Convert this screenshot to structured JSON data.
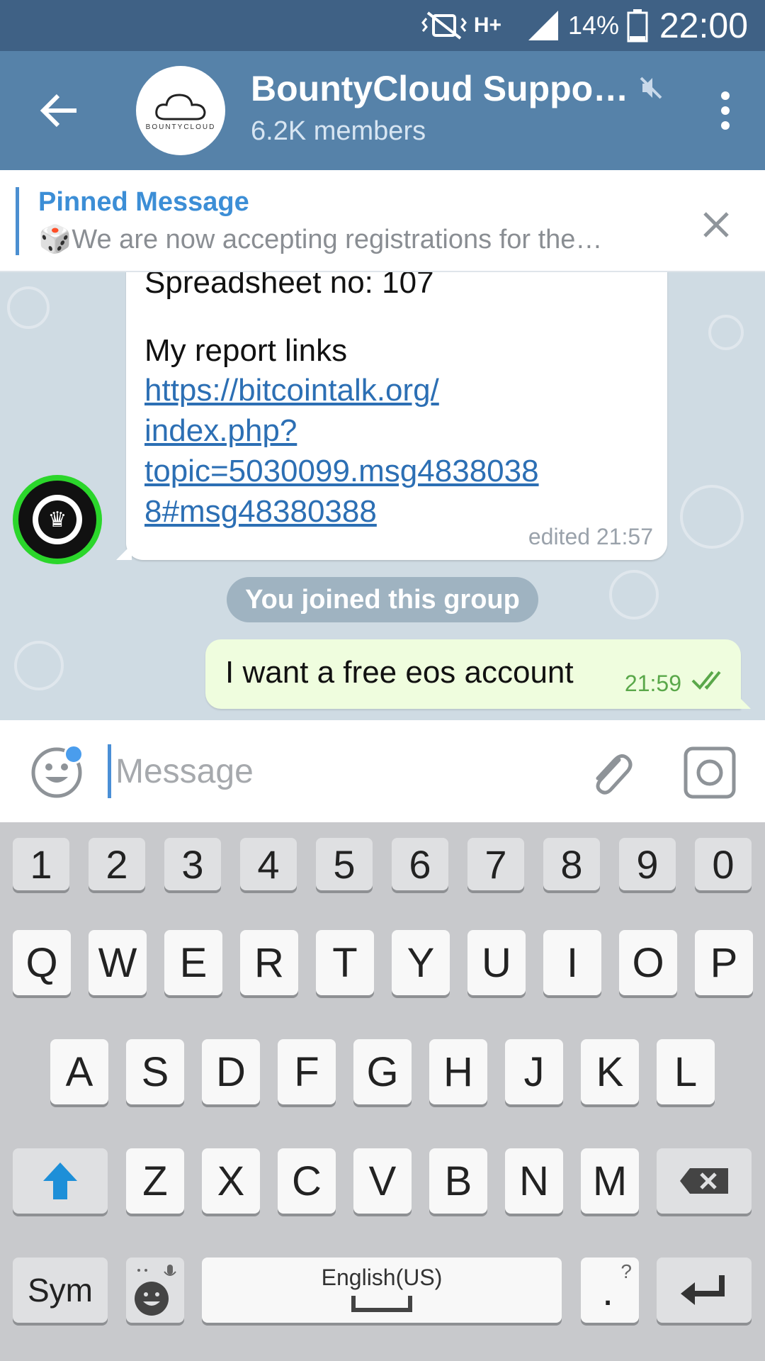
{
  "status_bar": {
    "network_type": "H+",
    "battery_percent": "14%",
    "time": "22:00",
    "icons": [
      "vibrate-mute-icon",
      "network-icon",
      "signal-icon",
      "battery-icon"
    ]
  },
  "header": {
    "chat_title": "BountyCloud Suppo…",
    "members": "6.2K members",
    "avatar_brand": "BOUNTYCLOUD",
    "colors": {
      "bar": "#5682a9",
      "status_bar": "#3f6185"
    }
  },
  "pinned": {
    "title": "Pinned Message",
    "text": "🎲We are now accepting registrations for the…"
  },
  "messages": {
    "incoming": {
      "line1": "Spreadsheet no: 107",
      "line2": "My report links",
      "link_lines": [
        "https://bitcointalk.org/",
        "index.php?",
        "topic=5030099.msg4838038",
        "8#msg48380388"
      ],
      "time": "edited 21:57"
    },
    "service": "You joined this group",
    "outgoing": {
      "text": "I want a free eos account",
      "time": "21:59"
    }
  },
  "input": {
    "placeholder": "Message",
    "value": ""
  },
  "keyboard": {
    "numbers": [
      "1",
      "2",
      "3",
      "4",
      "5",
      "6",
      "7",
      "8",
      "9",
      "0"
    ],
    "row1": [
      "Q",
      "W",
      "E",
      "R",
      "T",
      "Y",
      "U",
      "I",
      "O",
      "P"
    ],
    "row2": [
      "A",
      "S",
      "D",
      "F",
      "G",
      "H",
      "J",
      "K",
      "L"
    ],
    "row3": [
      "Z",
      "X",
      "C",
      "V",
      "B",
      "N",
      "M"
    ],
    "sym_label": "Sym",
    "space_label": "English(US)",
    "period_label": ".",
    "period_hint": "?"
  }
}
